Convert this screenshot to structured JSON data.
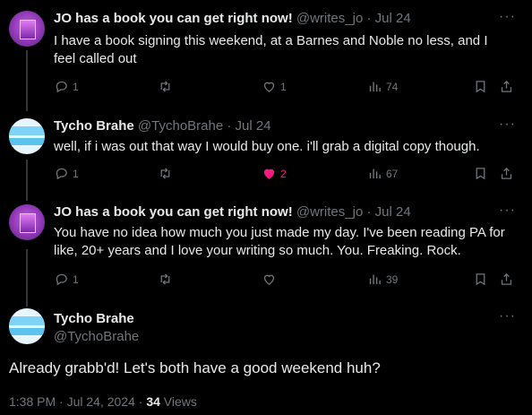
{
  "replies": [
    {
      "name": "JO has a book you can get right now!",
      "handle": "@writes_jo",
      "sep": "·",
      "date": "Jul 24",
      "text": "I have a book signing this weekend, at a Barnes and Noble no less, and I feel called out",
      "reply_count": "1",
      "retweet_count": "",
      "like_count": "1",
      "view_count": "74",
      "liked": false
    },
    {
      "name": "Tycho Brahe",
      "handle": "@TychoBrahe",
      "sep": "·",
      "date": "Jul 24",
      "text": "well, if i was out that way I would buy one. i'll grab a digital copy though.",
      "reply_count": "1",
      "retweet_count": "",
      "like_count": "2",
      "view_count": "67",
      "liked": true
    },
    {
      "name": "JO has a book you can get right now!",
      "handle": "@writes_jo",
      "sep": "·",
      "date": "Jul 24",
      "text": "You have no idea how much you just made my day. I've been reading PA for like, 20+ years and I love your writing so much. You. Freaking. Rock.",
      "reply_count": "1",
      "retweet_count": "",
      "like_count": "",
      "view_count": "39",
      "liked": false
    }
  ],
  "focus": {
    "name": "Tycho Brahe",
    "handle": "@TychoBrahe",
    "text": "Already grabb'd! Let's both have a good weekend huh?",
    "timestamp": "1:38 PM · Jul 24, 2024 · ",
    "views_count": "34",
    "views_label": " Views"
  },
  "icons": {
    "more": "more-dots-icon",
    "reply": "reply-icon",
    "retweet": "retweet-icon",
    "like": "heart-icon",
    "views": "views-chart-icon",
    "bookmark": "bookmark-icon",
    "share": "share-icon"
  },
  "colors": {
    "like_active": "#f91880",
    "muted": "#71767b",
    "text": "#e7e9ea",
    "background": "#000000"
  }
}
